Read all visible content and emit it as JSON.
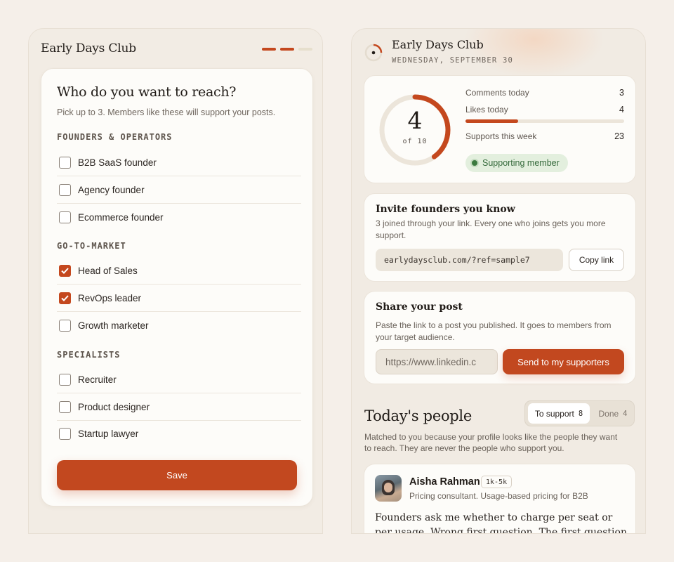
{
  "left": {
    "app_title": "Early Days Club",
    "heading": "Who do you want to reach?",
    "subheading": "Pick up to 3. Members like these will support your posts.",
    "groups": [
      {
        "label": "FOUNDERS & OPERATORS",
        "options": [
          {
            "label": "B2B SaaS founder",
            "checked": false
          },
          {
            "label": "Agency founder",
            "checked": false
          },
          {
            "label": "Ecommerce founder",
            "checked": false
          }
        ]
      },
      {
        "label": "GO-TO-MARKET",
        "options": [
          {
            "label": "Head of Sales",
            "checked": true
          },
          {
            "label": "RevOps leader",
            "checked": true
          },
          {
            "label": "Growth marketer",
            "checked": false
          }
        ]
      },
      {
        "label": "SPECIALISTS",
        "options": [
          {
            "label": "Recruiter",
            "checked": false
          },
          {
            "label": "Product designer",
            "checked": false
          },
          {
            "label": "Startup lawyer",
            "checked": false
          }
        ]
      }
    ],
    "save_label": "Save"
  },
  "right": {
    "app_title": "Early Days Club",
    "date": "WEDNESDAY, SEPTEMBER 30",
    "stats": {
      "ring_value": "4",
      "ring_of": "of 10",
      "ring_fraction": 0.4,
      "comments_label": "Comments today",
      "comments_value": "3",
      "likes_label": "Likes today",
      "likes_value": "4",
      "likes_fraction": 0.33,
      "supports_label": "Supports this week",
      "supports_value": "23",
      "badge": "Supporting member"
    },
    "invite": {
      "title": "Invite founders you know",
      "desc": "3 joined through your link. Every one who joins gets you more support.",
      "ref_link": "earlydaysclub.com/?ref=sample7",
      "copy_label": "Copy link"
    },
    "share": {
      "title": "Share your post",
      "desc": "Paste the link to a post you published. It goes to members from your target audience.",
      "input_value": "https://www.linkedin.c",
      "send_label": "Send to my supporters"
    },
    "people": {
      "title": "Today's people",
      "tab_to_support": "To support",
      "tab_to_support_count": "8",
      "tab_done": "Done",
      "tab_done_count": "4",
      "desc": "Matched to you because your profile looks like the people they want to reach. They are never the people who support you.",
      "person": {
        "name": "Aisha Rahman",
        "tag": "1k-5k",
        "role": "Pricing consultant. Usage-based pricing for B2B",
        "post": "Founders ask me whether to charge per seat or per usage. Wrong first question. The first question is what"
      }
    },
    "colors": {
      "accent": "#c4481e",
      "badge_bg": "#e3efde",
      "badge_text": "#356a3b"
    }
  }
}
